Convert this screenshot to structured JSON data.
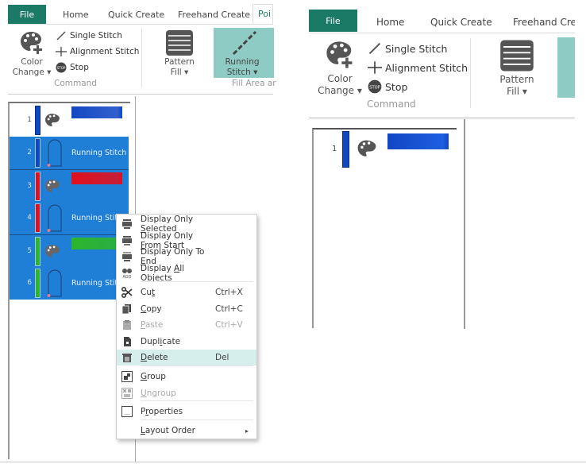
{
  "left": {
    "tabs": [
      "File",
      "Home",
      "Quick Create",
      "Freehand Create",
      "Poi"
    ],
    "ribbon": {
      "color_change": "Color\nChange ▾",
      "single_stitch": "Single Stitch",
      "alignment_stitch": "Alignment Stitch",
      "stop": "Stop",
      "command_group": "Command",
      "pattern_fill": "Pattern\nFill ▾",
      "running_stitch": "Running\nStitch ▾",
      "fill_group": "Fill Area ar"
    },
    "objects": [
      {
        "num": "1",
        "type": "color",
        "color": "#1247c4",
        "selected": false
      },
      {
        "num": "2",
        "type": "stitch",
        "label": "Running Stitch",
        "color": "#1247c4",
        "selected": true
      },
      {
        "num": "3",
        "type": "color",
        "color": "#e0101e",
        "selected": true
      },
      {
        "num": "4",
        "type": "stitch",
        "label": "Running Stitc",
        "color": "#e0101e",
        "selected": true
      },
      {
        "num": "5",
        "type": "color",
        "color": "#2db52d",
        "selected": true
      },
      {
        "num": "6",
        "type": "stitch",
        "label": "Running Stitc",
        "color": "#2db52d",
        "selected": true
      }
    ]
  },
  "context_menu": {
    "items": [
      {
        "pre": "Display Only ",
        "u": "S",
        "post": "elected",
        "shortcut": "",
        "icon": "display-selected-icon"
      },
      {
        "pre": "Display Only ",
        "u": "F",
        "post": "rom Start",
        "shortcut": "",
        "icon": "display-from-start-icon"
      },
      {
        "pre": "Display Only To ",
        "u": "E",
        "post": "nd",
        "shortcut": "",
        "icon": "display-to-end-icon"
      },
      {
        "pre": "Display ",
        "u": "A",
        "post": "ll Objects",
        "shortcut": "",
        "icon": "display-all-icon"
      },
      {
        "pre": "Cu",
        "u": "t",
        "post": "",
        "shortcut": "Ctrl+X",
        "icon": "scissors-icon"
      },
      {
        "pre": "",
        "u": "C",
        "post": "opy",
        "shortcut": "Ctrl+C",
        "icon": "copy-icon"
      },
      {
        "pre": "",
        "u": "P",
        "post": "aste",
        "shortcut": "Ctrl+V",
        "icon": "paste-icon",
        "disabled": true
      },
      {
        "pre": "Dupl",
        "u": "i",
        "post": "cate",
        "shortcut": "",
        "icon": "duplicate-icon"
      },
      {
        "pre": "",
        "u": "D",
        "post": "elete",
        "shortcut": "Del",
        "icon": "trash-icon",
        "highlight": true
      },
      {
        "pre": "",
        "u": "G",
        "post": "roup",
        "shortcut": "",
        "icon": "group-icon"
      },
      {
        "pre": "",
        "u": "U",
        "post": "ngroup",
        "shortcut": "",
        "icon": "ungroup-icon",
        "disabled": true
      },
      {
        "pre": "P",
        "u": "r",
        "post": "operties",
        "shortcut": "",
        "icon": "properties-icon"
      },
      {
        "pre": "",
        "u": "L",
        "post": "ayout Order",
        "shortcut": "▸",
        "icon": ""
      }
    ]
  },
  "right": {
    "tabs": [
      "File",
      "Home",
      "Quick Create",
      "Freehand Cre"
    ],
    "ribbon": {
      "color_change": "Color\nChange ▾",
      "single_stitch": "Single Stitch",
      "alignment_stitch": "Alignment Stitch",
      "stop": "Stop",
      "command_group": "Command",
      "pattern_fill": "Pattern\nFill ▾"
    },
    "objects": [
      {
        "num": "1",
        "type": "color",
        "color": "#1247c4",
        "selected": false
      }
    ]
  }
}
